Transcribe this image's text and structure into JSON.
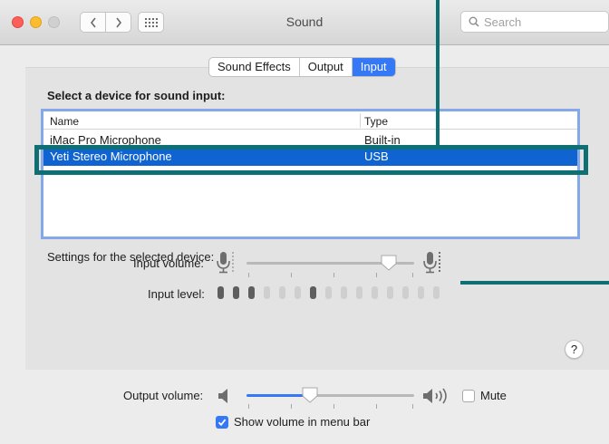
{
  "window": {
    "title": "Sound"
  },
  "search": {
    "placeholder": "Search"
  },
  "tabs": [
    {
      "label": "Sound Effects",
      "active": false
    },
    {
      "label": "Output",
      "active": false
    },
    {
      "label": "Input",
      "active": true
    }
  ],
  "input_section": {
    "heading": "Select a device for sound input:",
    "columns": {
      "name": "Name",
      "type": "Type"
    },
    "devices": [
      {
        "name": "iMac Pro Microphone",
        "type": "Built-in",
        "selected": false
      },
      {
        "name": "Yeti Stereo Microphone",
        "type": "USB",
        "selected": true
      }
    ]
  },
  "settings": {
    "heading": "Settings for the selected device:",
    "input_volume_label": "Input volume:",
    "input_volume_value": 0.85,
    "input_level_label": "Input level:",
    "input_level_bars_total": 15,
    "input_level_bars_lit": 3
  },
  "output": {
    "volume_label": "Output volume:",
    "volume_value": 0.38,
    "mute_label": "Mute",
    "mute_checked": false,
    "show_in_menubar_label": "Show volume in menu bar",
    "show_in_menubar_checked": true
  },
  "help": {
    "label": "?"
  },
  "colors": {
    "accent": "#3478f6",
    "selection": "#0f64d2",
    "annotation": "#0e7072"
  }
}
